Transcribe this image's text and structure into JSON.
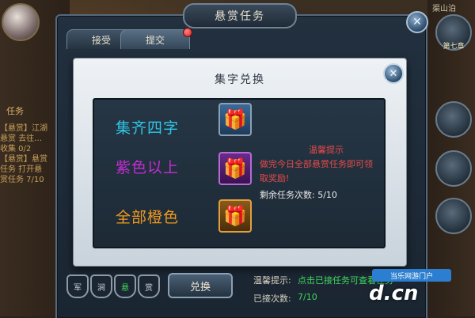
{
  "window": {
    "title": "悬赏任务",
    "tabs": [
      {
        "label": "接受",
        "active": false
      },
      {
        "label": "提交",
        "active": true,
        "has_notification": true
      }
    ],
    "top_right_text": "渠山泊"
  },
  "background": {
    "side_labels": [
      "任务"
    ],
    "side_text": "【悬赏】江湖悬赏 去往…收集 0/2 【悬赏】悬赏任务 打开悬赏任务 7/10",
    "right_buttons": [
      {
        "label": "第七章",
        "icon": "character-icon"
      },
      {
        "label": "",
        "icon": "tree-icon"
      },
      {
        "label": "",
        "icon": "sword-icon"
      },
      {
        "label": "",
        "icon": "swirl-icon"
      }
    ]
  },
  "modal": {
    "title": "集字兑换",
    "rows": [
      {
        "label": "集齐四字",
        "color": "#2fc6e6",
        "gift": "blue-gift-icon"
      },
      {
        "label": "紫色以上",
        "color": "#c52bd6",
        "gift": "purple-gift-icon"
      },
      {
        "label": "全部橙色",
        "color": "#f29a1c",
        "gift": "orange-gift-icon"
      }
    ],
    "hint_title": "温馨提示",
    "hint_body": "做完今日全部悬赏任务即可领取奖励!",
    "remaining_label": "剩余任务次数: 5/10"
  },
  "bottom": {
    "shields": [
      "军",
      "涧",
      "悬",
      "赏"
    ],
    "exchange_label": "兑换",
    "tip_label": "温馨提示:",
    "tip_text": "点击已接任务可查看任务",
    "accepted_label": "已接次数:",
    "accepted_value": "7/10"
  },
  "watermark": {
    "badge": "当乐网游门户",
    "text": "d.cn"
  },
  "colors": {
    "accent_green": "#3fd65a",
    "hint_red": "#e64a4a"
  }
}
